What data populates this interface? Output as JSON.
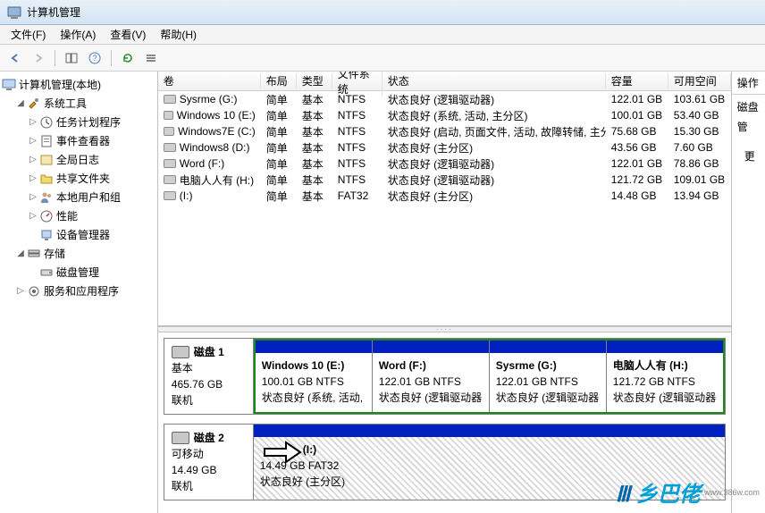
{
  "window": {
    "title": "计算机管理"
  },
  "menu": {
    "file": "文件(F)",
    "action": "操作(A)",
    "view": "查看(V)",
    "help": "帮助(H)"
  },
  "tree": {
    "root": "计算机管理(本地)",
    "system_tools": "系统工具",
    "task_scheduler": "任务计划程序",
    "event_viewer": "事件查看器",
    "global_log": "全局日志",
    "shared_folders": "共享文件夹",
    "local_users": "本地用户和组",
    "performance": "性能",
    "device_manager": "设备管理器",
    "storage": "存储",
    "disk_mgmt": "磁盘管理",
    "services_apps": "服务和应用程序"
  },
  "columns": {
    "volume": "卷",
    "layout": "布局",
    "type": "类型",
    "fs": "文件系统",
    "status": "状态",
    "capacity": "容量",
    "free": "可用空间"
  },
  "volumes": [
    {
      "name": "Sysrme (G:)",
      "layout": "简单",
      "type": "基本",
      "fs": "NTFS",
      "status": "状态良好 (逻辑驱动器)",
      "capacity": "122.01 GB",
      "free": "103.61 GB"
    },
    {
      "name": "Windows 10 (E:)",
      "layout": "简单",
      "type": "基本",
      "fs": "NTFS",
      "status": "状态良好 (系统, 活动, 主分区)",
      "capacity": "100.01 GB",
      "free": "53.40 GB"
    },
    {
      "name": "Windows7E (C:)",
      "layout": "简单",
      "type": "基本",
      "fs": "NTFS",
      "status": "状态良好 (启动, 页面文件, 活动, 故障转储, 主分区)",
      "capacity": "75.68 GB",
      "free": "15.30 GB"
    },
    {
      "name": "Windows8 (D:)",
      "layout": "简单",
      "type": "基本",
      "fs": "NTFS",
      "status": "状态良好 (主分区)",
      "capacity": "43.56 GB",
      "free": "7.60 GB"
    },
    {
      "name": "Word (F:)",
      "layout": "简单",
      "type": "基本",
      "fs": "NTFS",
      "status": "状态良好 (逻辑驱动器)",
      "capacity": "122.01 GB",
      "free": "78.86 GB"
    },
    {
      "name": "电脑人人有 (H:)",
      "layout": "简单",
      "type": "基本",
      "fs": "NTFS",
      "status": "状态良好 (逻辑驱动器)",
      "capacity": "121.72 GB",
      "free": "109.01 GB"
    },
    {
      "name": "(I:)",
      "layout": "简单",
      "type": "基本",
      "fs": "FAT32",
      "status": "状态良好 (主分区)",
      "capacity": "14.48 GB",
      "free": "13.94 GB"
    }
  ],
  "disk1": {
    "title": "磁盘 1",
    "type": "基本",
    "size": "465.76 GB",
    "online": "联机",
    "parts": [
      {
        "name": "Windows 10  (E:)",
        "size": "100.01 GB NTFS",
        "status": "状态良好 (系统, 活动,"
      },
      {
        "name": "Word  (F:)",
        "size": "122.01 GB NTFS",
        "status": "状态良好 (逻辑驱动器"
      },
      {
        "name": "Sysrme  (G:)",
        "size": "122.01 GB NTFS",
        "status": "状态良好 (逻辑驱动器"
      },
      {
        "name": "电脑人人有  (H:)",
        "size": "121.72 GB NTFS",
        "status": "状态良好 (逻辑驱动器"
      }
    ]
  },
  "disk2": {
    "title": "磁盘 2",
    "type": "可移动",
    "size": "14.49 GB",
    "online": "联机",
    "part": {
      "name": "(I:)",
      "size": "14.49 GB FAT32",
      "status": "状态良好 (主分区)"
    }
  },
  "actions": {
    "header": "操作",
    "link1": "磁盘管",
    "link2": "更"
  },
  "watermark": {
    "logo": "川乡巴佬",
    "url": "www.386w.com"
  }
}
